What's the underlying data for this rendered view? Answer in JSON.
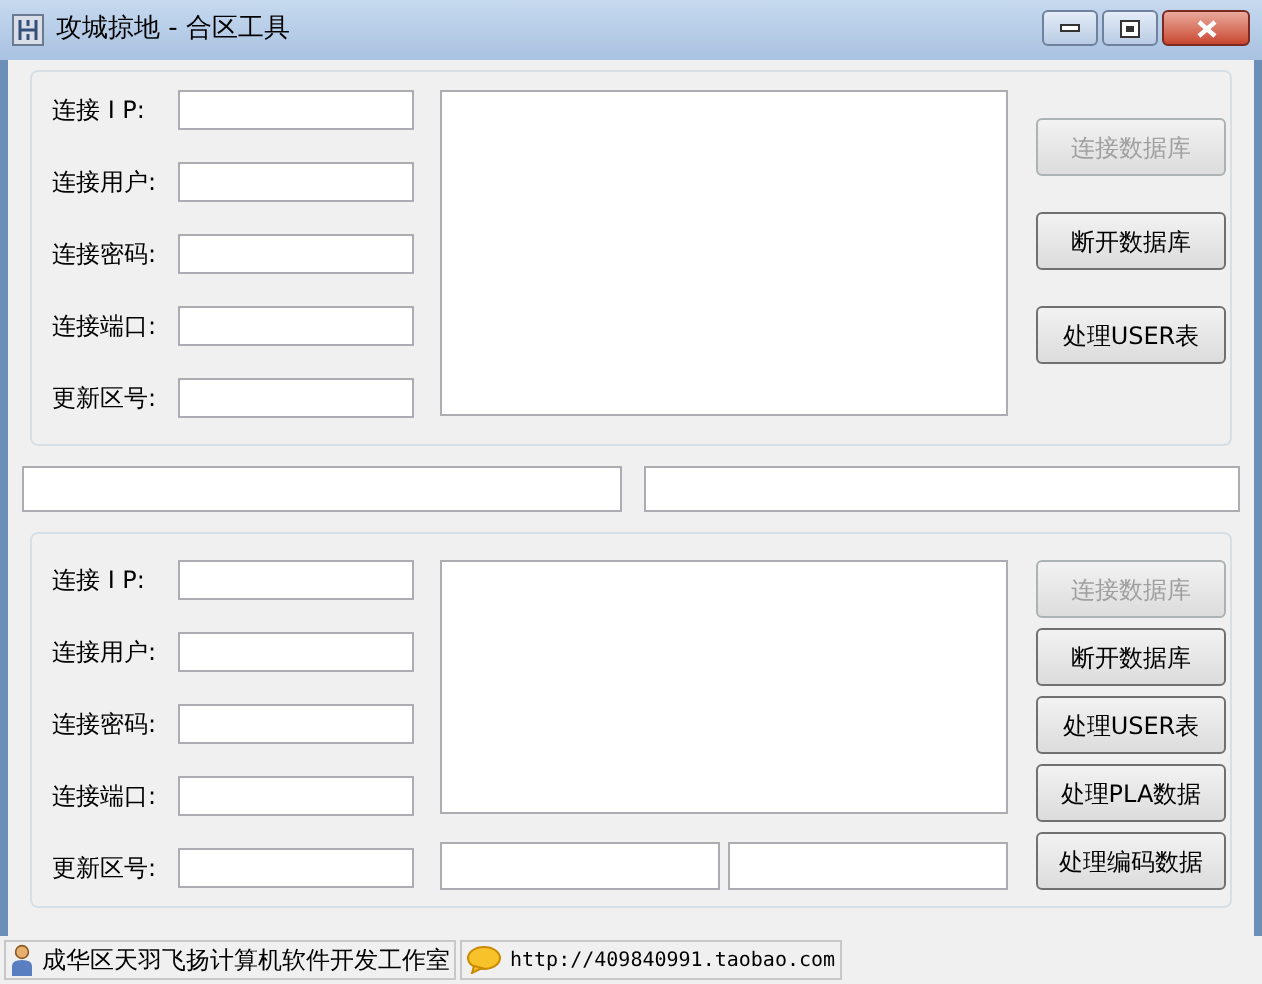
{
  "window": {
    "title": "攻城掠地 - 合区工具"
  },
  "panels": [
    {
      "fields": [
        {
          "label": "连接 I P:"
        },
        {
          "label": "连接用户:"
        },
        {
          "label": "连接密码:"
        },
        {
          "label": "连接端口:"
        },
        {
          "label": "更新区号:"
        }
      ],
      "buttons": [
        {
          "label": "连接数据库",
          "disabled": true
        },
        {
          "label": "断开数据库",
          "disabled": false
        },
        {
          "label": "处理USER表",
          "disabled": false
        }
      ],
      "has_bottom_fields": false
    },
    {
      "fields": [
        {
          "label": "连接 I P:"
        },
        {
          "label": "连接用户:"
        },
        {
          "label": "连接密码:"
        },
        {
          "label": "连接端口:"
        },
        {
          "label": "更新区号:"
        }
      ],
      "buttons": [
        {
          "label": "连接数据库",
          "disabled": true
        },
        {
          "label": "断开数据库",
          "disabled": false
        },
        {
          "label": "处理USER表",
          "disabled": false
        },
        {
          "label": "处理PLA数据",
          "disabled": false
        },
        {
          "label": "处理编码数据",
          "disabled": false
        }
      ],
      "has_bottom_fields": true
    }
  ],
  "status_bar": [
    {
      "kind": "person",
      "text": "成华区天羽飞扬计算机软件开发工作室"
    },
    {
      "kind": "chat",
      "text": "http://409840991.taobao.com"
    }
  ]
}
